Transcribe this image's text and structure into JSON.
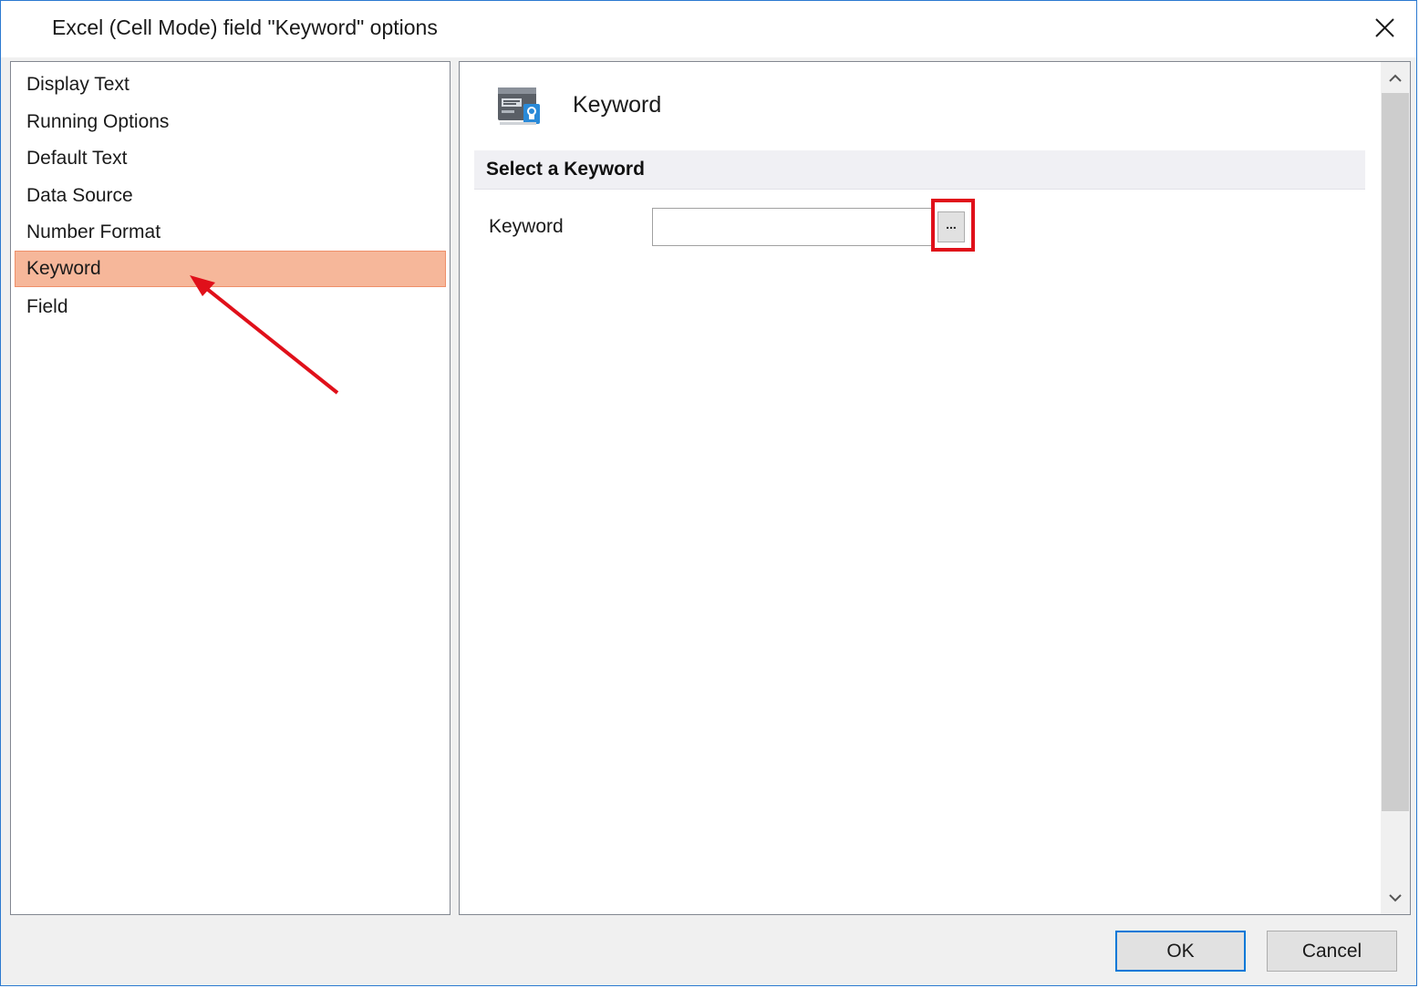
{
  "window": {
    "title": "Excel (Cell Mode) field \"Keyword\" options"
  },
  "sidebar": {
    "items": [
      {
        "label": "Display Text",
        "selected": false
      },
      {
        "label": "Running Options",
        "selected": false
      },
      {
        "label": "Default Text",
        "selected": false
      },
      {
        "label": "Data Source",
        "selected": false
      },
      {
        "label": "Number Format",
        "selected": false
      },
      {
        "label": "Keyword",
        "selected": true
      },
      {
        "label": "Field",
        "selected": false
      }
    ]
  },
  "main": {
    "header_title": "Keyword",
    "header_icon": "keyword-field-icon",
    "section_title": "Select a Keyword",
    "keyword_field": {
      "label": "Keyword",
      "value": "",
      "browse_label": "..."
    }
  },
  "footer": {
    "ok_label": "OK",
    "cancel_label": "Cancel"
  },
  "colors": {
    "selected_item": "#f6b79a",
    "annotation": "#e0101a",
    "window_border": "#2b79d0",
    "ok_focus_border": "#0078d7"
  },
  "annotations": {
    "arrow_target": "sidebar-item-keyword",
    "highlight_target": "keyword-browse-button"
  }
}
